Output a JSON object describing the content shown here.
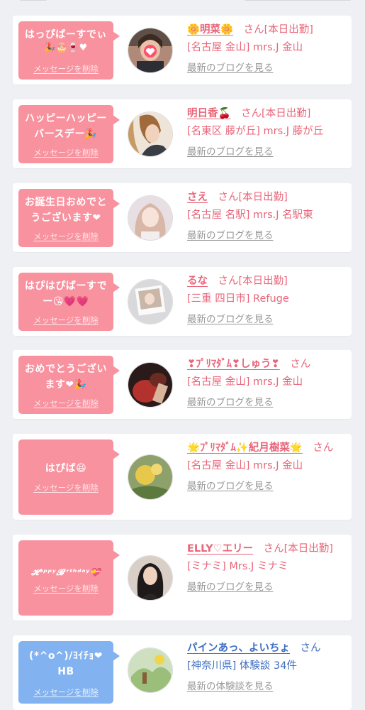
{
  "cards": [
    {
      "message": "はっぴばーすでぃ",
      "emoji": "🎉🎂🍷♥",
      "delete_label": "メッセージを削除",
      "name": "🌼明菜🌼",
      "suffix": "さん[本日出勤]",
      "shop": "[名古屋 金山] mrs.J 金山",
      "link": "最新のブログを見る"
    },
    {
      "message": "ハッピーハッピーバースデー🎉",
      "emoji": "",
      "delete_label": "メッセージを削除",
      "name": "明日香🍒",
      "suffix": "さん[本日出勤]",
      "shop": "[名東区 藤が丘] mrs.J 藤が丘",
      "link": "最新のブログを見る"
    },
    {
      "message": "お誕生日おめでとうございます❤",
      "emoji": "",
      "delete_label": "メッセージを削除",
      "name": "さえ",
      "suffix": "さん[本日出勤]",
      "shop": "[名古屋 名駅] mrs.J 名駅東",
      "link": "最新のブログを見る"
    },
    {
      "message": "はぴはぴばーすでー😘💗💗",
      "emoji": "",
      "delete_label": "メッセージを削除",
      "name": "るな",
      "suffix": "さん[本日出勤]",
      "shop": "[三重 四日市] Refuge",
      "link": "最新のブログを見る"
    },
    {
      "message": "おめでとうございます❤🎉",
      "emoji": "",
      "delete_label": "メッセージを削除",
      "name": "❣ﾌﾟﾘﾏﾀﾞﾑ❣しゅう❣",
      "suffix": "さん",
      "shop": "[名古屋 金山] mrs.J 金山",
      "link": "最新のブログを見る"
    },
    {
      "message": "はぴば😆",
      "emoji": "",
      "delete_label": "メッセージを削除",
      "name": "🌟ﾌﾟﾘﾏﾀﾞﾑ✨紀月樹菜🌟",
      "suffix": "さん",
      "shop": "[名古屋 金山] mrs.J 金山",
      "link": "最新のブログを見る"
    },
    {
      "message": "𝓗ᵃᵖᵖʸ𝓑ⁱʳᵗʰᵈᵃʸ💝",
      "emoji": "",
      "delete_label": "メッセージを削除",
      "name": "ELLY♡エリー",
      "suffix": "さん[本日出勤]",
      "shop": "[ミナミ] Mrs.J ミナミ",
      "link": "最新のブログを見る"
    },
    {
      "message": "(*^o^)/ﾖｲﾁｮ❤HB",
      "emoji": "",
      "delete_label": "メッセージを削除",
      "name": "パインあっ、よいちょ",
      "suffix": "さん",
      "shop": "[神奈川県] 体験談 34件",
      "link": "最新の体験談を見る"
    }
  ]
}
